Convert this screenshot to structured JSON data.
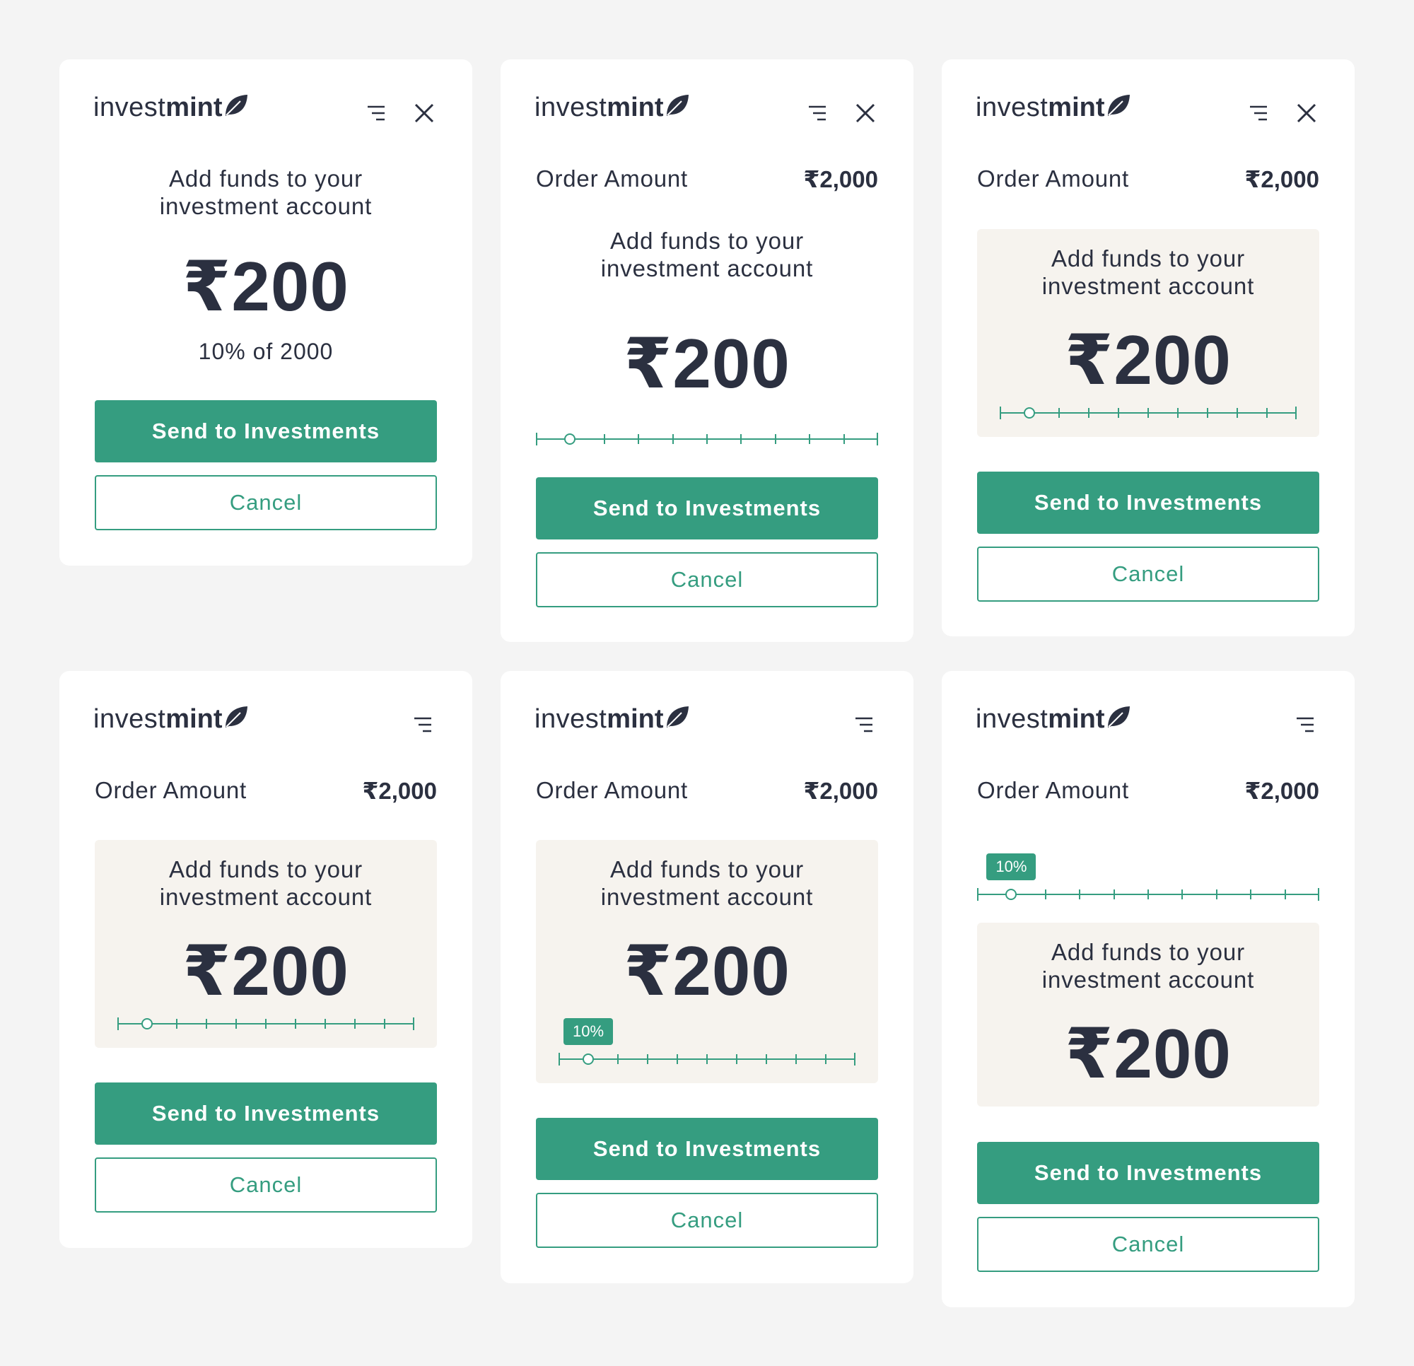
{
  "brand": {
    "light": "invest",
    "bold": "mint",
    "icon": "leaf-icon"
  },
  "icons": {
    "menu": "menu-icon",
    "close": "close-icon"
  },
  "colors": {
    "accent": "#359d80",
    "text": "#2b3040",
    "panel": "#f6f3ee",
    "background": "#f4f4f4"
  },
  "common": {
    "order_label": "Order Amount",
    "order_value": "₹2,000",
    "add_line1": "Add funds to your",
    "add_line2": "investment account",
    "amount": "₹200",
    "send_label": "Send to Investments",
    "cancel_label": "Cancel"
  },
  "cards": [
    {
      "variant": 1,
      "percent_text": "10% of 2000"
    },
    {
      "variant": 2,
      "slider": {
        "value_fraction": 0.1
      }
    },
    {
      "variant": 3,
      "slider": {
        "value_fraction": 0.1
      }
    },
    {
      "variant": 4,
      "slider": {
        "value_fraction": 0.1
      }
    },
    {
      "variant": 5,
      "slider": {
        "value_fraction": 0.1,
        "badge": "10%"
      }
    },
    {
      "variant": 6,
      "slider": {
        "value_fraction": 0.1,
        "badge": "10%"
      }
    }
  ]
}
